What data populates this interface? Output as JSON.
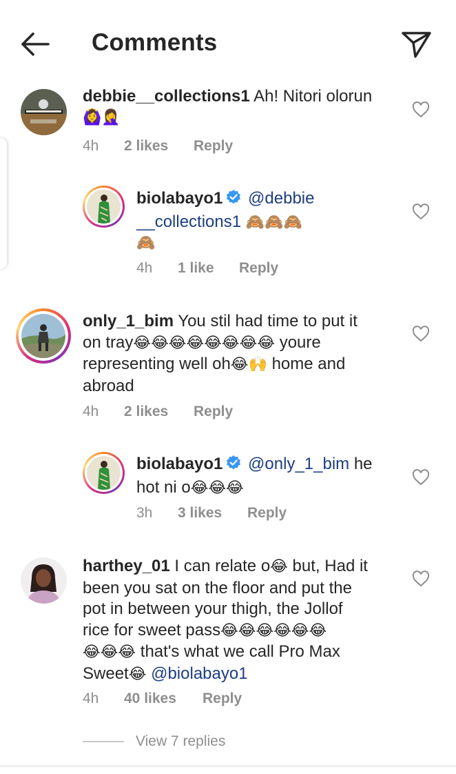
{
  "header": {
    "title": "Comments",
    "back_icon": "arrow-left-icon",
    "send_icon": "paper-plane-icon"
  },
  "colors": {
    "text": "#262626",
    "muted": "#8e8e8e",
    "mention": "#1c3d82",
    "verified": "#3897f0"
  },
  "comments": [
    {
      "username": "debbie__collections1",
      "text": "Ah! Nitori olorun",
      "emoji_line": "🙆‍♀️🤦‍♀️",
      "time": "4h",
      "likes": "2 likes",
      "reply": "Reply"
    },
    {
      "username": "biolabayo1",
      "mention": "@debbie",
      "line2_mention": "__collections1",
      "line2_emoji": "🙈🙈🙈",
      "line3_emoji": "🙈",
      "time": "4h",
      "likes": "1 like",
      "reply": "Reply"
    },
    {
      "username": "only_1_bim",
      "line1_text": "You stil had time to put it",
      "line2_text_a": "on tray",
      "line2_emoji": "😂😂😂😂😂😂😂😂",
      "line2_text_b": " youre",
      "line3_text_a": "representing well oh",
      "line3_emoji": "😂🙌",
      "line3_text_b": " home and",
      "line4_text": "abroad",
      "time": "4h",
      "likes": "2 likes",
      "reply": "Reply"
    },
    {
      "username": "biolabayo1",
      "mention": "@only_1_bim",
      "line1_text": " he",
      "line2_text": "hot ni o",
      "line2_emoji": "😂😂😂",
      "time": "3h",
      "likes": "3 likes",
      "reply": "Reply"
    },
    {
      "username": "harthey_01",
      "line1_text_a": "I can relate o",
      "line1_emoji": "😂",
      "line1_text_b": " but, Had it",
      "line2_text": "been you sat on the floor and put the",
      "line3_text": "pot in between your thigh, the Jollof",
      "line4_text": "rice for sweet pass",
      "line4_emoji": "😂😂😂😂😂😂",
      "line5_emoji": "😂😂😂",
      "line5_text": " that's what we call Pro Max",
      "line6_text": "Sweet",
      "line6_emoji": "😂",
      "line6_mention": " @biolabayo1",
      "time": "4h",
      "likes": "40 likes",
      "reply": "Reply"
    }
  ],
  "view_replies": "View 7 replies"
}
